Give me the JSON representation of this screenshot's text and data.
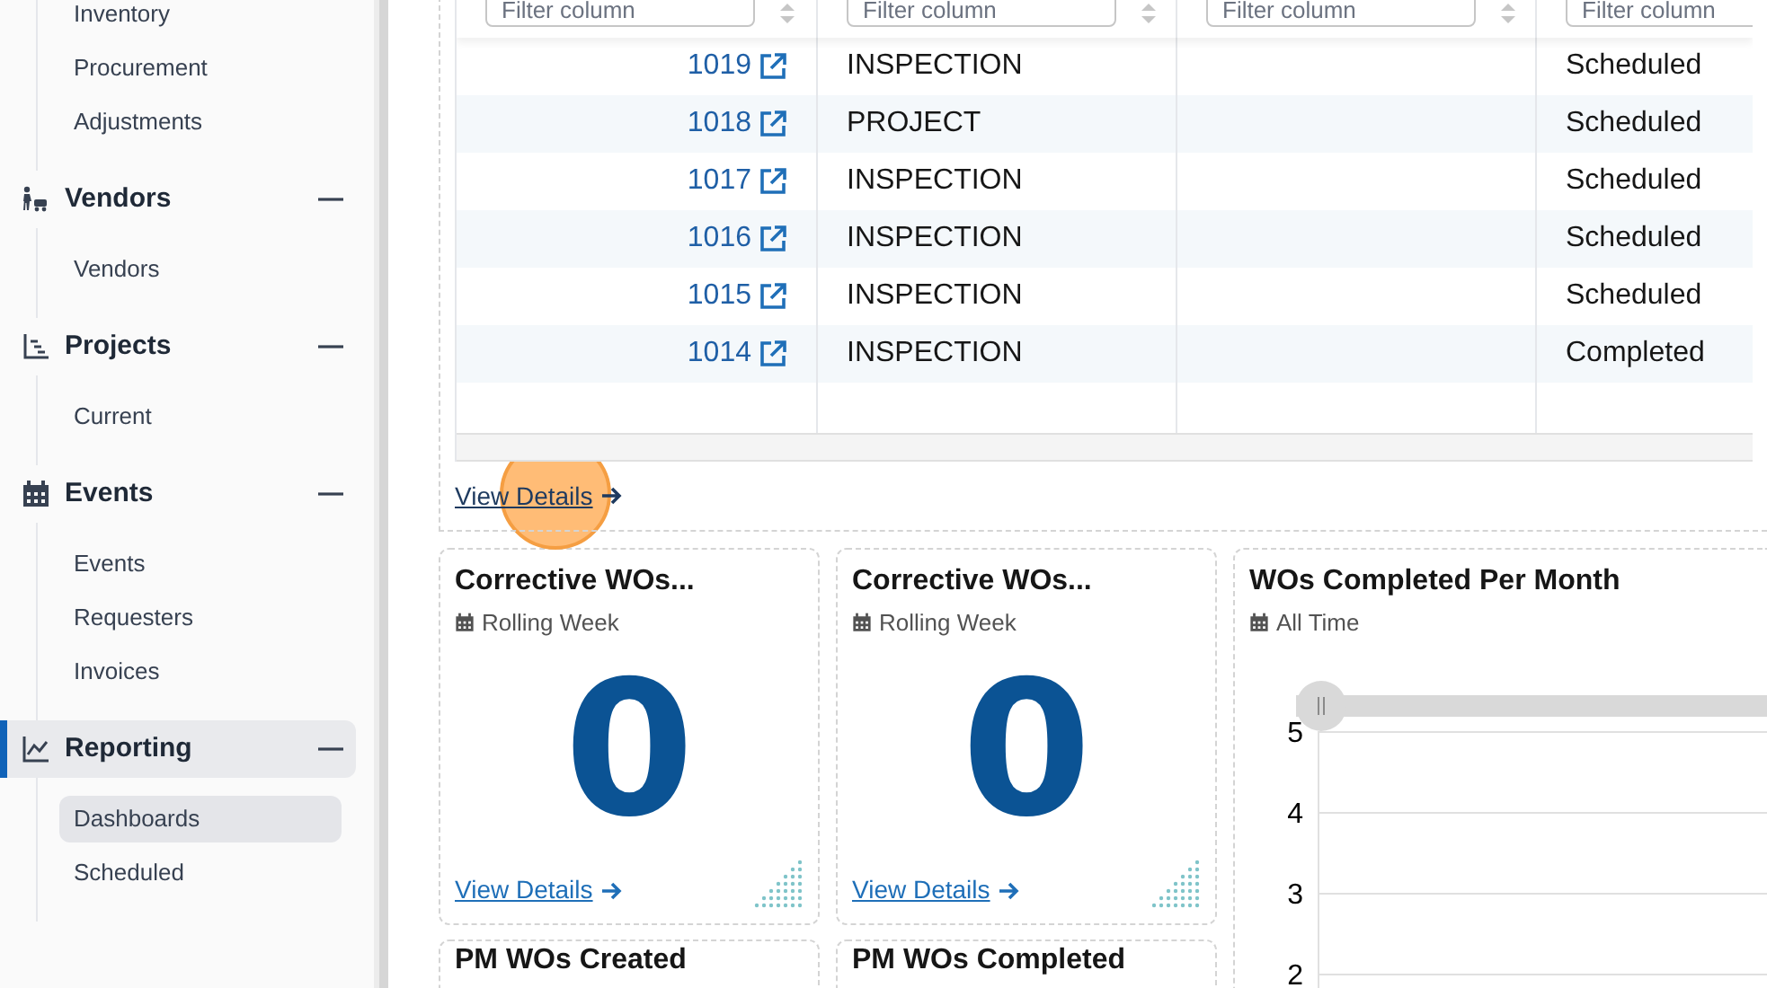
{
  "sidebar": {
    "top_items": [
      {
        "label": "Inventory",
        "selected": false
      },
      {
        "label": "Procurement",
        "selected": false
      },
      {
        "label": "Adjustments",
        "selected": false
      }
    ],
    "groups": [
      {
        "title": "Vendors",
        "expanded": true,
        "selected": false,
        "items": [
          {
            "label": "Vendors",
            "selected": false
          }
        ]
      },
      {
        "title": "Projects",
        "expanded": true,
        "selected": false,
        "items": [
          {
            "label": "Current",
            "selected": false
          }
        ]
      },
      {
        "title": "Events",
        "expanded": true,
        "selected": false,
        "items": [
          {
            "label": "Events",
            "selected": false
          },
          {
            "label": "Requesters",
            "selected": false
          },
          {
            "label": "Invoices",
            "selected": false
          }
        ]
      },
      {
        "title": "Reporting",
        "expanded": true,
        "selected": true,
        "items": [
          {
            "label": "Dashboards",
            "selected": true
          },
          {
            "label": "Scheduled",
            "selected": false
          }
        ]
      }
    ]
  },
  "table": {
    "filters": [
      {
        "placeholder": "Filter column"
      },
      {
        "placeholder": "Filter column"
      },
      {
        "placeholder": "Filter column"
      },
      {
        "placeholder": "Filter column"
      }
    ],
    "rows": [
      {
        "id": "1019",
        "type": "INSPECTION",
        "status": "Scheduled"
      },
      {
        "id": "1018",
        "type": "PROJECT",
        "status": "Scheduled"
      },
      {
        "id": "1017",
        "type": "INSPECTION",
        "status": "Scheduled"
      },
      {
        "id": "1016",
        "type": "INSPECTION",
        "status": "Scheduled"
      },
      {
        "id": "1015",
        "type": "INSPECTION",
        "status": "Scheduled"
      },
      {
        "id": "1014",
        "type": "INSPECTION",
        "status": "Completed"
      }
    ],
    "link": "View Details"
  },
  "widgets": [
    {
      "kind": "number",
      "title": "Corrective WOs...",
      "period": "Rolling Week",
      "value": "0",
      "link": "View Details"
    },
    {
      "kind": "number",
      "title": "Corrective WOs...",
      "period": "Rolling Week",
      "value": "0",
      "link": "View Details"
    },
    {
      "kind": "cut",
      "title": "PM WOs Created"
    },
    {
      "kind": "cut",
      "title": "PM WOs Completed"
    }
  ],
  "chart_widget": {
    "kind": "chart",
    "title": "WOs Completed Per Month",
    "period": "All Time",
    "range_slider": {
      "level": 0
    },
    "y_ticks": [
      "5",
      "4",
      "3",
      "2"
    ]
  }
}
